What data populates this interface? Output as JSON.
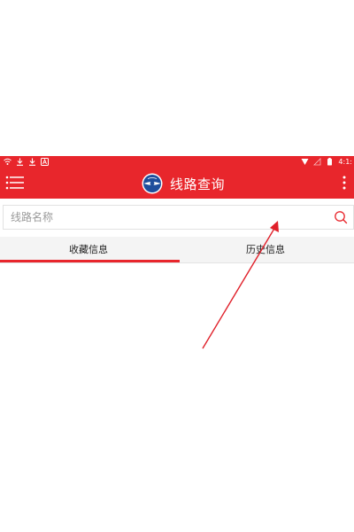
{
  "colors": {
    "brand_red": "#e8262c",
    "annotation_red": "#e0202a",
    "tab_background": "#f4f4f4",
    "placeholder_gray": "#9a9a9a"
  },
  "status_bar": {
    "left_icons": [
      "wifi-icon",
      "download-icon",
      "download-icon",
      "notification-a-icon"
    ],
    "right_icons": [
      "signal-icon",
      "sim-icon",
      "battery-icon"
    ],
    "time": "4:1:"
  },
  "app_bar": {
    "menu_icon": "hamburger-menu-icon",
    "logo_icon": "airline-logo-icon",
    "title": "线路查询",
    "overflow_icon": "more-vertical-icon"
  },
  "search": {
    "value": "",
    "placeholder": "线路名称",
    "icon": "search-icon"
  },
  "tabs": [
    {
      "label": "收藏信息",
      "selected": true
    },
    {
      "label": "历史信息",
      "selected": false
    }
  ],
  "annotation": {
    "type": "arrow",
    "icon": "annotation-arrow-icon"
  }
}
